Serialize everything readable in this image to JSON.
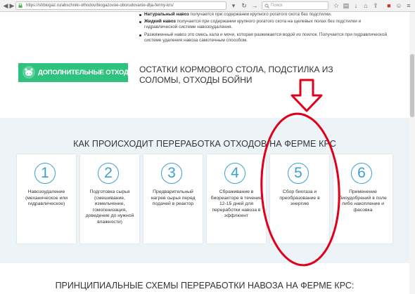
{
  "browser": {
    "url": "https://shbiogaz.ru/abschniki-othodov/biogazovoe-oborudovanie-dlja-fermy-krs/",
    "search_placeholder": "Поиск"
  },
  "bullets": [
    {
      "bold": "Натуральный навоз",
      "text": " получается при содержании крупного рогатого скота без подстилки."
    },
    {
      "bold": "Жидкий навоз",
      "text": " получается при содержании крупного рогатого скота на щелевых полах без подстилки и гидравлической системе навозоудаления."
    },
    {
      "bold": "",
      "text": "Разжиженный навоз это смесь кала и мочи, которая разжижается водой из поилок. Получается при гидравлической системе удаления навоза самотечным способом."
    }
  ],
  "extra_waste": {
    "badge": "ДОПОЛНИТЕЛЬНЫЕ ОТХОДЫ",
    "text": "ОСТАТКИ КОРМОВОГО СТОЛА, ПОДСТИЛКА ИЗ СОЛОМЫ, ОТХОДЫ БОЙНИ"
  },
  "process": {
    "title": "КАК ПРОИСХОДИТ ПЕРЕРАБОТКА ОТХОДОВ НА ФЕРМЕ КРС",
    "steps": [
      {
        "num": "1",
        "text": "Навозоудаление (механическое или гидравлическое)"
      },
      {
        "num": "2",
        "text": "Подготовка сырья (смешивание, измельчение, гомогенизация, доведение до нужной влажности)"
      },
      {
        "num": "3",
        "text": "Предварительный нагрев сырья перед подачей в реактор"
      },
      {
        "num": "4",
        "text": "Сбраживание в биореакторе в течение 12-15 дней для переработки навоза в эффлюент"
      },
      {
        "num": "5",
        "text": "Сбор биогаза и преобразование в энергию"
      },
      {
        "num": "6",
        "text": "Применение биоудобрений в поле либо накопление и фасовка"
      }
    ]
  },
  "schemes_title": "ПРИНЦИПИАЛЬНЫЕ СХЕМЫ ПЕРЕРАБОТКИ НАВОЗА НА ФЕРМЕ КРС:",
  "colors": {
    "accent": "#3aa0d0",
    "badge": "#2ec27e",
    "annotation": "#e0001a"
  }
}
